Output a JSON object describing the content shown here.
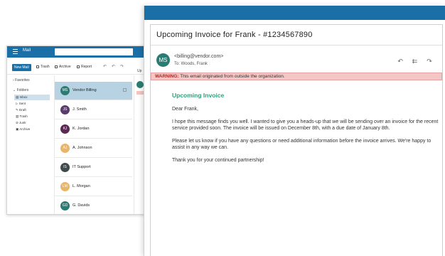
{
  "bg_client": {
    "app_title": "Mail",
    "toolbar": {
      "new_mail": "New Mail",
      "trash": "Trash",
      "archive": "Archive",
      "report": "Report"
    },
    "favorites_label": "Favorites",
    "folders_label": "Folders",
    "folders": [
      "Inbox",
      "Sent",
      "Draft",
      "Trash",
      "Junk",
      "Archive"
    ],
    "messages": [
      {
        "initials": "MS",
        "name": "Vendor Billing",
        "color": "#2a7c72"
      },
      {
        "initials": "JS",
        "name": "J. Smith",
        "color": "#5b3a6e"
      },
      {
        "initials": "KJ",
        "name": "K. Jordan",
        "color": "#5b2a52"
      },
      {
        "initials": "AJ",
        "name": "A. Johnson",
        "color": "#e8b56a"
      },
      {
        "initials": "IS",
        "name": "IT Support",
        "color": "#3e4a4e"
      },
      {
        "initials": "LM",
        "name": "L. Morgan",
        "color": "#e8b56a"
      },
      {
        "initials": "GD",
        "name": "G. Davids",
        "color": "#2a7c72"
      }
    ],
    "reading_pane_label": "Up"
  },
  "email": {
    "subject": "Upcoming Invoice for Frank - #1234567890",
    "sender_initials": "MS",
    "from": "<billing@vendor.com>",
    "to": "To: Woods, Frank",
    "warning_label": "WARNING:",
    "warning_text": " This email originated from outside the organization.",
    "heading": "Upcoming Invoice",
    "greeting": "Dear Frank,",
    "para1": "I hope this message finds you well. I wanted to give you a heads-up that we will be sending over an invoice for the recent service provided soon. The invoice will be issued on December 8th, with a due date of January 8th.",
    "para2": "Please let us know if you have any questions or need additional information before the invoice arrives. We're happy to assist in any way we can.",
    "closing": "Thank you for your continued partnership!"
  },
  "colors": {
    "brand": "#1a6fa7",
    "accent_green": "#2aa27d",
    "warning_bg": "#f5c6c6",
    "selected_row": "#b7d3e3"
  }
}
